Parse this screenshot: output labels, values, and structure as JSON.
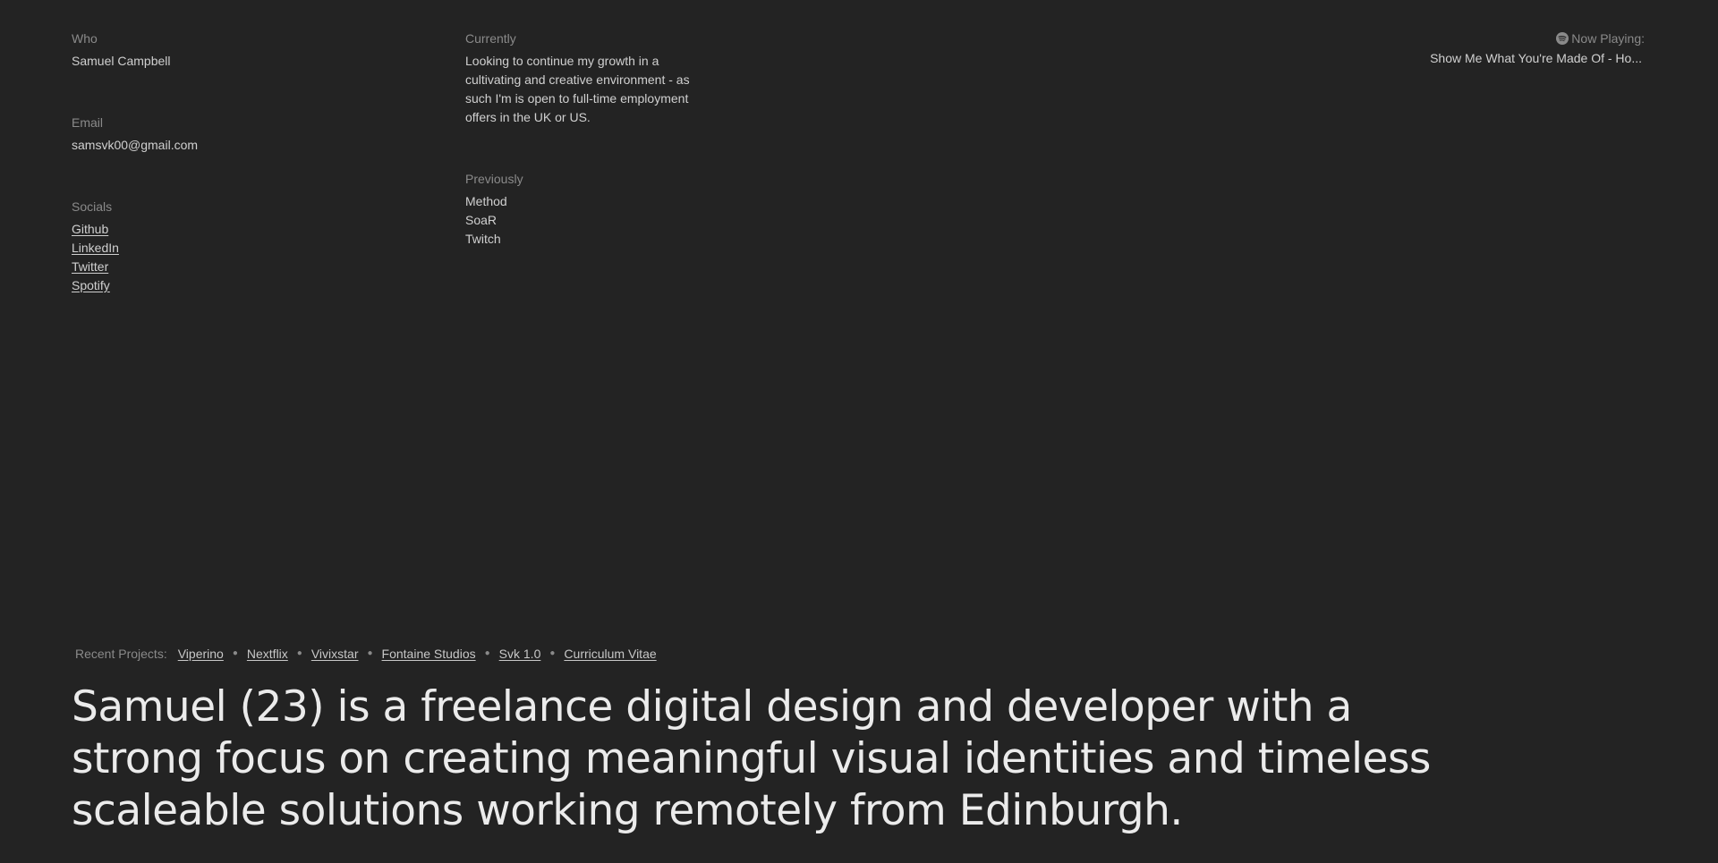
{
  "who": {
    "label": "Who",
    "value": "Samuel Campbell"
  },
  "email": {
    "label": "Email",
    "value": "samsvk00@gmail.com"
  },
  "socials": {
    "label": "Socials",
    "links": [
      "Github",
      "LinkedIn",
      "Twitter",
      "Spotify"
    ]
  },
  "currently": {
    "label": "Currently",
    "text": "Looking to continue my growth in a cultivating and creative environment - as such I'm is open to full-time employment offers in the UK or US."
  },
  "previously": {
    "label": "Previously",
    "items": [
      "Method",
      "SoaR",
      "Twitch"
    ]
  },
  "now_playing": {
    "label": "Now Playing:",
    "icon": "spotify-icon",
    "track": "Show Me What You're Made Of - Ho..."
  },
  "recent_projects": {
    "label": "Recent Projects:",
    "links": [
      "Viperino",
      "Nextflix",
      "Vivixstar",
      "Fontaine Studios",
      "Svk 1.0",
      "Curriculum Vitae"
    ]
  },
  "bio": "Samuel (23) is a freelance digital design and developer with a strong focus on creating meaningful visual identities and timeless scaleable solutions working remotely from Edinburgh.",
  "colors": {
    "background": "#232323",
    "label": "#8a8a8a",
    "text": "#d0d0d0",
    "headline": "#ebebeb"
  }
}
